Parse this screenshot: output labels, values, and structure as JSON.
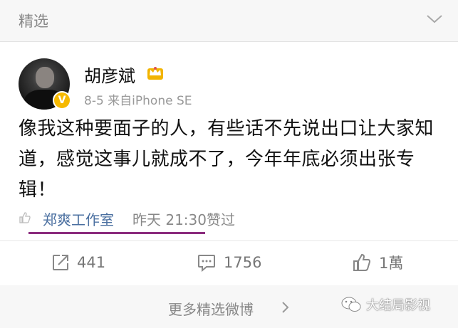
{
  "header": {
    "title": "精选",
    "chevron_icon": "chevron-down-icon"
  },
  "post": {
    "username": "胡彦斌",
    "verified_badge": "V",
    "meta": "8-5 来自iPhone SE",
    "text": "像我这种要面子的人，有些话不先说出口让大家知道，感觉这事儿就成不了，今年年底必须出张专辑！",
    "liker": "郑爽工作室",
    "liked_time": "昨天 21:30赞过"
  },
  "actions": {
    "repost_count": "441",
    "comment_count": "1756",
    "like_count": "1萬"
  },
  "footer": {
    "more_label": "更多精选微博",
    "watermark": "大结局影视"
  },
  "colors": {
    "accent_link": "#4a6fa0",
    "underline": "#8b2c7e",
    "badge": "#f6b900"
  }
}
